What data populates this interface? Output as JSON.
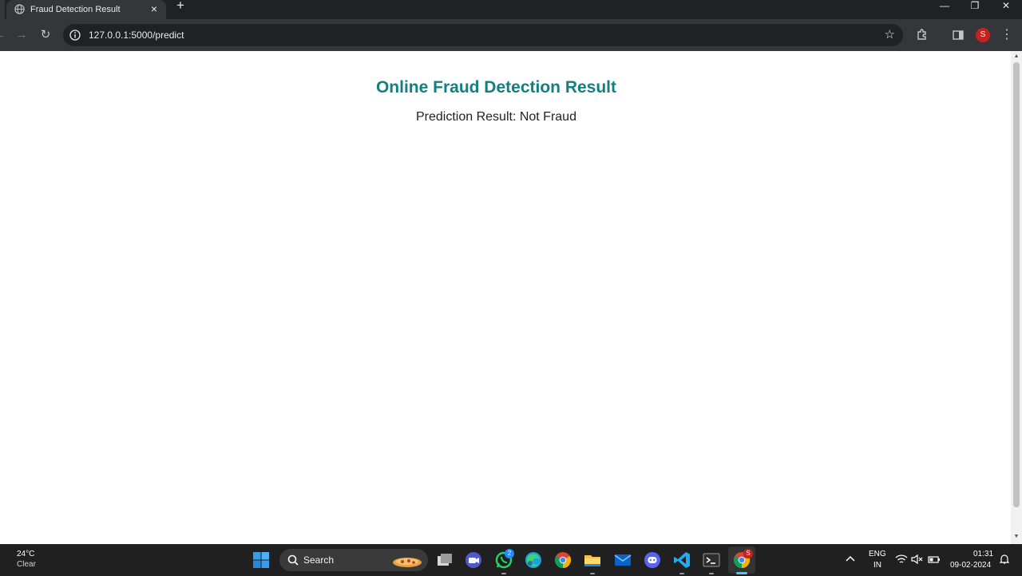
{
  "browser": {
    "tab": {
      "title": "Fraud Detection Result",
      "close_glyph": "×",
      "favicon": "globe-icon"
    },
    "new_tab_glyph": "+",
    "window_controls": {
      "minimize": "—",
      "maximize": "❐",
      "close": "✕"
    },
    "nav": {
      "back": "←",
      "forward": "→",
      "reload": "↻"
    },
    "url": "127.0.0.1:5000/predict",
    "bookmark_glyph": "☆",
    "profile_initial": "S",
    "menu_glyph": "⋮"
  },
  "page": {
    "heading": "Online Fraud Detection Result",
    "result_line": "Prediction Result: Not Fraud",
    "heading_color": "#127f80"
  },
  "taskbar": {
    "weather": {
      "temp": "24°C",
      "desc": "Clear"
    },
    "search_label": "Search",
    "apps": [
      {
        "name": "task-view-icon"
      },
      {
        "name": "zoom-meeting-icon"
      },
      {
        "name": "whatsapp-icon",
        "badge": "2"
      },
      {
        "name": "edge-icon"
      },
      {
        "name": "chrome-icon"
      },
      {
        "name": "file-explorer-icon"
      },
      {
        "name": "mail-icon"
      },
      {
        "name": "discord-icon"
      },
      {
        "name": "vscode-icon"
      },
      {
        "name": "terminal-icon"
      },
      {
        "name": "chrome-profile-icon",
        "badge": "S"
      }
    ],
    "language": {
      "line1": "ENG",
      "line2": "IN"
    },
    "time": "01:31",
    "date": "09-02-2024"
  }
}
